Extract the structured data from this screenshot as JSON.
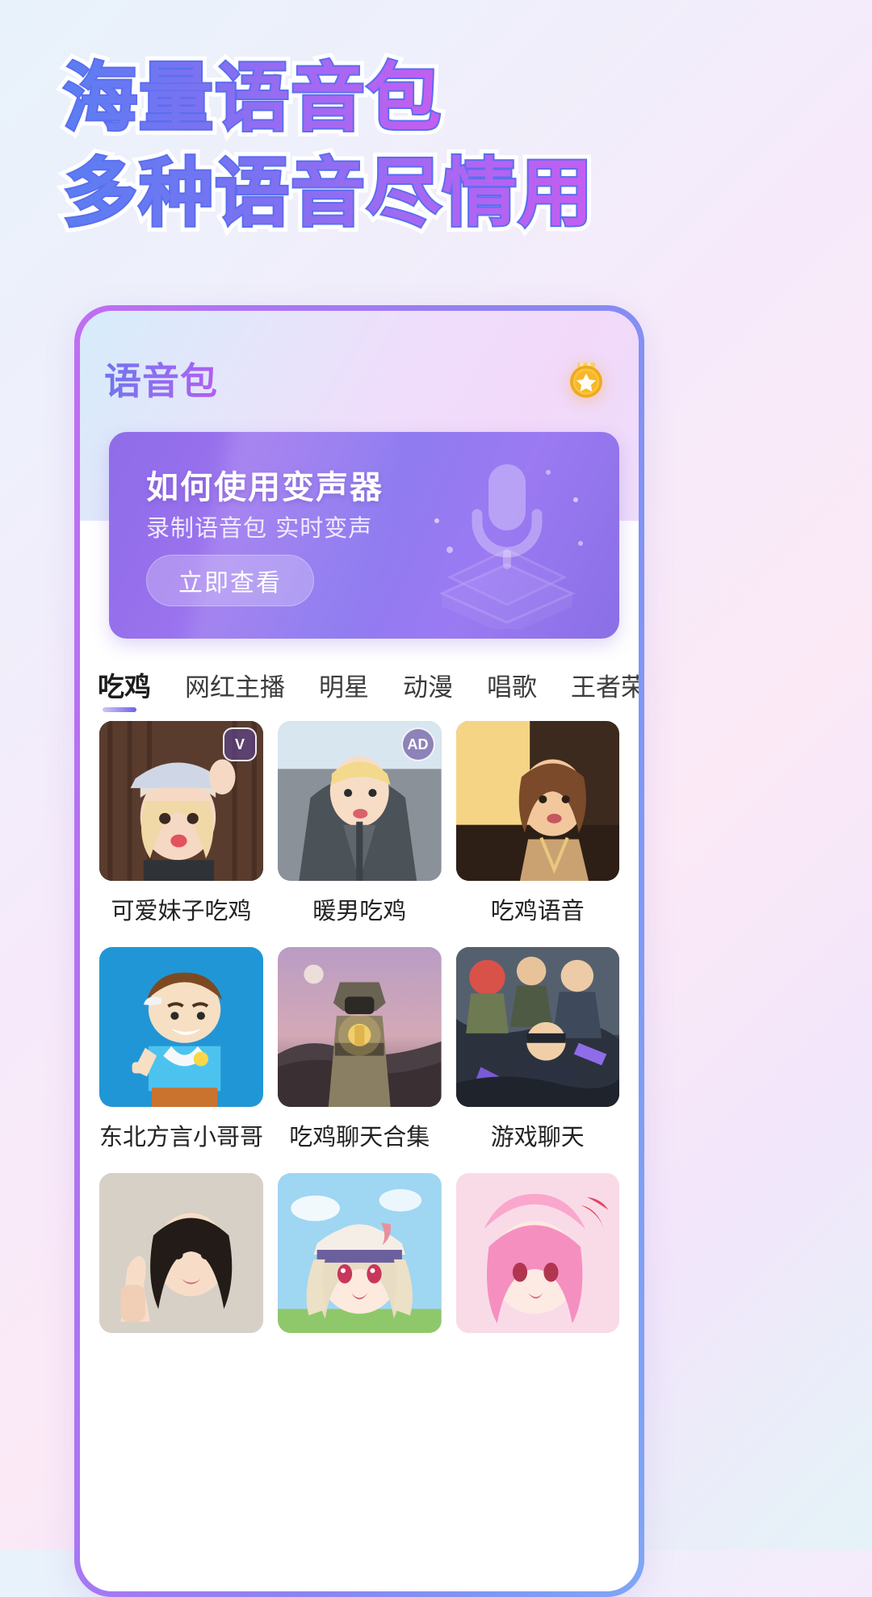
{
  "headline": {
    "line1": "海量语音包",
    "line2": "多种语音尽情用"
  },
  "colors": {
    "headline_gradient_start": "#5a7ef2",
    "headline_gradient_end": "#c45ef0",
    "headline_stroke": "#5b6ef0",
    "phone_border_start": "#c06df2",
    "phone_border_end": "#7fa6f6",
    "banner_bg": "#9a72ee",
    "tab_active_underline": "#6d63e8",
    "badge_gold": "#f5b731"
  },
  "app": {
    "title": "语音包",
    "medal_icon": "star-medal-icon"
  },
  "banner": {
    "title": "如何使用变声器",
    "subtitle": "录制语音包 实时变声",
    "button_label": "立即查看",
    "art_icon": "microphone-on-platform-icon"
  },
  "tabs": [
    {
      "label": "吃鸡",
      "active": true
    },
    {
      "label": "网红主播",
      "active": false
    },
    {
      "label": "明星",
      "active": false
    },
    {
      "label": "动漫",
      "active": false
    },
    {
      "label": "唱歌",
      "active": false
    },
    {
      "label": "王者荣耀",
      "active": false
    }
  ],
  "grid": [
    {
      "label": "可爱妹子吃鸡",
      "badge": "V",
      "badge_kind": "hex",
      "art": "girl-cap-pout"
    },
    {
      "label": "暖男吃鸡",
      "badge": "AD",
      "badge_kind": "round",
      "art": "boy-hoodie-car"
    },
    {
      "label": "吃鸡语音",
      "badge": "",
      "badge_kind": "",
      "art": "girl-braid-car"
    },
    {
      "label": "东北方言小哥哥",
      "badge": "",
      "badge_kind": "",
      "art": "cartoon-boy-blue"
    },
    {
      "label": "吃鸡聊天合集",
      "badge": "",
      "badge_kind": "",
      "art": "pubg-lantern-soldier"
    },
    {
      "label": "游戏聊天",
      "badge": "",
      "badge_kind": "",
      "art": "game-squad-poster"
    },
    {
      "label": "",
      "badge": "",
      "badge_kind": "",
      "art": "girl-thumbsup"
    },
    {
      "label": "",
      "badge": "",
      "badge_kind": "",
      "art": "anime-girl-bandana"
    },
    {
      "label": "",
      "badge": "",
      "badge_kind": "",
      "art": "anime-pink-hair"
    }
  ]
}
